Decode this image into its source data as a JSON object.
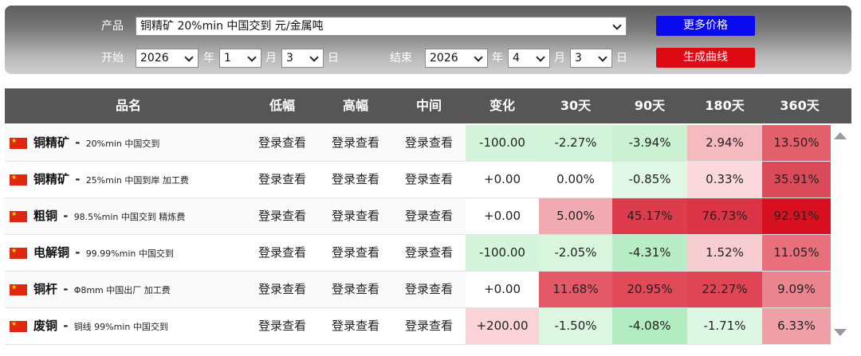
{
  "filter": {
    "product_label": "产品",
    "product_value": "铜精矿 20%min 中国交到 元/金属吨",
    "start_label": "开始",
    "end_label": "结束",
    "year_unit": "年",
    "month_unit": "月",
    "day_unit": "日",
    "start": {
      "year": "2026",
      "month": "1",
      "day": "3"
    },
    "end": {
      "year": "2026",
      "month": "4",
      "day": "3"
    },
    "more_prices_button": "更多价格",
    "generate_curve_button": "生成曲线"
  },
  "table": {
    "headers": [
      "品名",
      "低幅",
      "高幅",
      "中间",
      "变化",
      "30天",
      "90天",
      "180天",
      "360天"
    ],
    "rows": [
      {
        "name": "铜精矿",
        "spec": "20%min 中国交到",
        "low": "登录查看",
        "high": "登录查看",
        "mid": "登录查看",
        "change": "-100.00",
        "d30": "-2.27%",
        "d90": "-3.94%",
        "d180": "2.94%",
        "d360": "13.50%"
      },
      {
        "name": "铜精矿",
        "spec": "25%min 中国到岸 加工费",
        "low": "登录查看",
        "high": "登录查看",
        "mid": "登录查看",
        "change": "+0.00",
        "d30": "0.00%",
        "d90": "-0.85%",
        "d180": "0.33%",
        "d360": "35.91%"
      },
      {
        "name": "粗铜",
        "spec": "98.5%min 中国交到 精炼费",
        "low": "登录查看",
        "high": "登录查看",
        "mid": "登录查看",
        "change": "+0.00",
        "d30": "5.00%",
        "d90": "45.17%",
        "d180": "76.73%",
        "d360": "92.91%"
      },
      {
        "name": "电解铜",
        "spec": "99.99%min 中国交到",
        "low": "登录查看",
        "high": "登录查看",
        "mid": "登录查看",
        "change": "-100.00",
        "d30": "-2.05%",
        "d90": "-4.31%",
        "d180": "1.52%",
        "d360": "11.05%"
      },
      {
        "name": "铜杆",
        "spec": "Φ8mm 中国出厂 加工费",
        "low": "登录查看",
        "high": "登录查看",
        "mid": "登录查看",
        "change": "+0.00",
        "d30": "11.68%",
        "d90": "20.95%",
        "d180": "22.27%",
        "d360": "9.09%"
      },
      {
        "name": "废铜",
        "spec": "铜线 99%min 中国交到",
        "low": "登录查看",
        "high": "登录查看",
        "mid": "登录查看",
        "change": "+200.00",
        "d30": "-1.50%",
        "d90": "-4.08%",
        "d180": "-1.71%",
        "d360": "6.33%"
      }
    ],
    "cell_colors": [
      {
        "change": "#d4f5dc",
        "d30": "#d2f4da",
        "d90": "#c9f1d2",
        "d180": "#f5b9c0",
        "d360": "#e25f6c"
      },
      {
        "change": "#ffffff",
        "d30": "#ffffff",
        "d90": "#e0f7e5",
        "d180": "#fad8dc",
        "d360": "#db4a58"
      },
      {
        "change": "#ffffff",
        "d30": "#f2aab2",
        "d90": "#dc3c4c",
        "d180": "#db3444",
        "d360": "#d8101f"
      },
      {
        "change": "#d4f5dc",
        "d30": "#d8f6de",
        "d90": "#b8edc5",
        "d180": "#f8cdd2",
        "d360": "#e8707c"
      },
      {
        "change": "#ffffff",
        "d30": "#e35967",
        "d90": "#e04a59",
        "d180": "#df4555",
        "d360": "#ea8590"
      },
      {
        "change": "#fad3d8",
        "d30": "#dcf6e2",
        "d90": "#b3ecc0",
        "d180": "#def7e4",
        "d360": "#f0a0a9"
      }
    ]
  }
}
